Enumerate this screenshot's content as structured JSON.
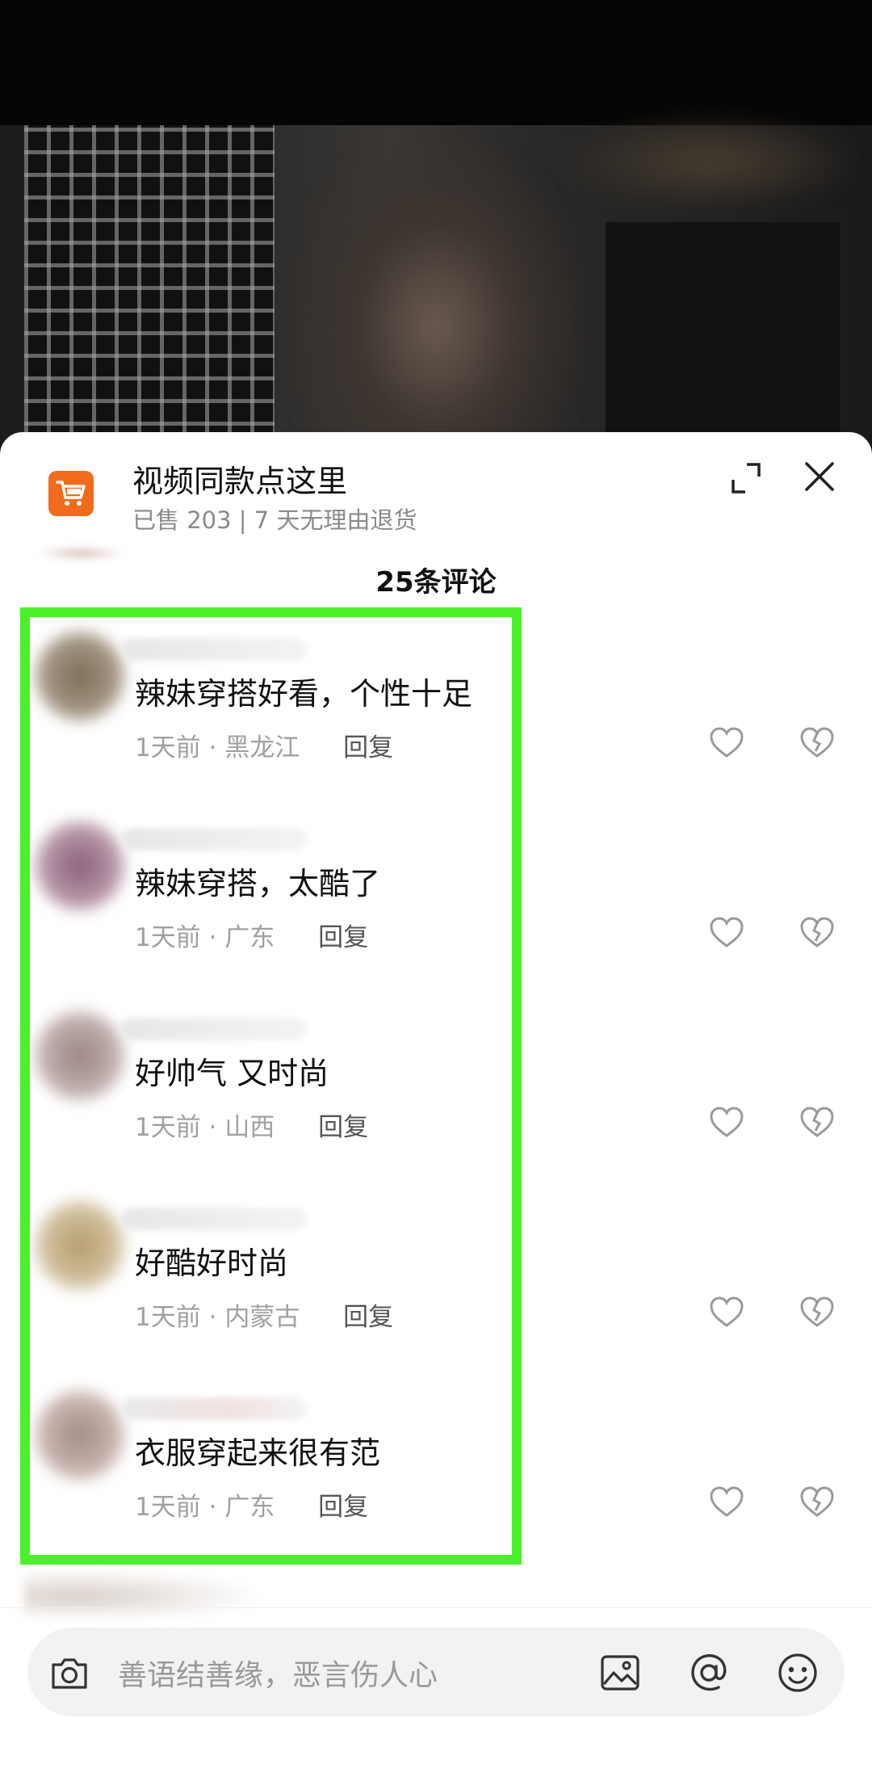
{
  "product": {
    "title": "视频同款点这里",
    "subtitle": "已售 203 | 7 天无理由退货",
    "icon": "shopping-cart-icon"
  },
  "comments_header": {
    "count_label": "25条评论"
  },
  "comments": [
    {
      "text": "辣妹穿搭好看，个性十足",
      "time": "1天前",
      "location": "黑龙江",
      "reply_label": "回复",
      "avatar_color": "#7b6a55"
    },
    {
      "text": "辣妹穿搭，太酷了",
      "time": "1天前",
      "location": "广东",
      "reply_label": "回复",
      "avatar_color": "#8a5f7a"
    },
    {
      "text": "好帅气 又时尚",
      "time": "1天前",
      "location": "山西",
      "reply_label": "回复",
      "avatar_color": "#9a8483"
    },
    {
      "text": "好酷好时尚",
      "time": "1天前",
      "location": "内蒙古",
      "reply_label": "回复",
      "avatar_color": "#b59b6a"
    },
    {
      "text": "衣服穿起来很有范",
      "time": "1天前",
      "location": "广东",
      "reply_label": "回复",
      "avatar_color": "#a48a84"
    }
  ],
  "input": {
    "placeholder": "善语结善缘，恶言伤人心"
  },
  "colors": {
    "accent_cart": "#f26b1d",
    "highlight_box": "#4cf02a"
  }
}
